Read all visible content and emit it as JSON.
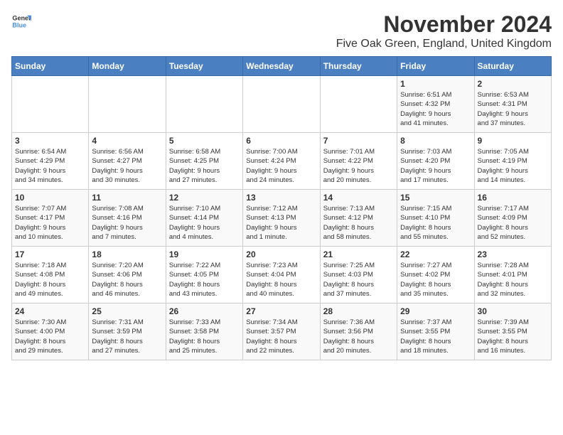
{
  "header": {
    "logo_general": "General",
    "logo_blue": "Blue",
    "month_title": "November 2024",
    "location": "Five Oak Green, England, United Kingdom"
  },
  "weekdays": [
    "Sunday",
    "Monday",
    "Tuesday",
    "Wednesday",
    "Thursday",
    "Friday",
    "Saturday"
  ],
  "weeks": [
    [
      {
        "day": "",
        "info": ""
      },
      {
        "day": "",
        "info": ""
      },
      {
        "day": "",
        "info": ""
      },
      {
        "day": "",
        "info": ""
      },
      {
        "day": "",
        "info": ""
      },
      {
        "day": "1",
        "info": "Sunrise: 6:51 AM\nSunset: 4:32 PM\nDaylight: 9 hours\nand 41 minutes."
      },
      {
        "day": "2",
        "info": "Sunrise: 6:53 AM\nSunset: 4:31 PM\nDaylight: 9 hours\nand 37 minutes."
      }
    ],
    [
      {
        "day": "3",
        "info": "Sunrise: 6:54 AM\nSunset: 4:29 PM\nDaylight: 9 hours\nand 34 minutes."
      },
      {
        "day": "4",
        "info": "Sunrise: 6:56 AM\nSunset: 4:27 PM\nDaylight: 9 hours\nand 30 minutes."
      },
      {
        "day": "5",
        "info": "Sunrise: 6:58 AM\nSunset: 4:25 PM\nDaylight: 9 hours\nand 27 minutes."
      },
      {
        "day": "6",
        "info": "Sunrise: 7:00 AM\nSunset: 4:24 PM\nDaylight: 9 hours\nand 24 minutes."
      },
      {
        "day": "7",
        "info": "Sunrise: 7:01 AM\nSunset: 4:22 PM\nDaylight: 9 hours\nand 20 minutes."
      },
      {
        "day": "8",
        "info": "Sunrise: 7:03 AM\nSunset: 4:20 PM\nDaylight: 9 hours\nand 17 minutes."
      },
      {
        "day": "9",
        "info": "Sunrise: 7:05 AM\nSunset: 4:19 PM\nDaylight: 9 hours\nand 14 minutes."
      }
    ],
    [
      {
        "day": "10",
        "info": "Sunrise: 7:07 AM\nSunset: 4:17 PM\nDaylight: 9 hours\nand 10 minutes."
      },
      {
        "day": "11",
        "info": "Sunrise: 7:08 AM\nSunset: 4:16 PM\nDaylight: 9 hours\nand 7 minutes."
      },
      {
        "day": "12",
        "info": "Sunrise: 7:10 AM\nSunset: 4:14 PM\nDaylight: 9 hours\nand 4 minutes."
      },
      {
        "day": "13",
        "info": "Sunrise: 7:12 AM\nSunset: 4:13 PM\nDaylight: 9 hours\nand 1 minute."
      },
      {
        "day": "14",
        "info": "Sunrise: 7:13 AM\nSunset: 4:12 PM\nDaylight: 8 hours\nand 58 minutes."
      },
      {
        "day": "15",
        "info": "Sunrise: 7:15 AM\nSunset: 4:10 PM\nDaylight: 8 hours\nand 55 minutes."
      },
      {
        "day": "16",
        "info": "Sunrise: 7:17 AM\nSunset: 4:09 PM\nDaylight: 8 hours\nand 52 minutes."
      }
    ],
    [
      {
        "day": "17",
        "info": "Sunrise: 7:18 AM\nSunset: 4:08 PM\nDaylight: 8 hours\nand 49 minutes."
      },
      {
        "day": "18",
        "info": "Sunrise: 7:20 AM\nSunset: 4:06 PM\nDaylight: 8 hours\nand 46 minutes."
      },
      {
        "day": "19",
        "info": "Sunrise: 7:22 AM\nSunset: 4:05 PM\nDaylight: 8 hours\nand 43 minutes."
      },
      {
        "day": "20",
        "info": "Sunrise: 7:23 AM\nSunset: 4:04 PM\nDaylight: 8 hours\nand 40 minutes."
      },
      {
        "day": "21",
        "info": "Sunrise: 7:25 AM\nSunset: 4:03 PM\nDaylight: 8 hours\nand 37 minutes."
      },
      {
        "day": "22",
        "info": "Sunrise: 7:27 AM\nSunset: 4:02 PM\nDaylight: 8 hours\nand 35 minutes."
      },
      {
        "day": "23",
        "info": "Sunrise: 7:28 AM\nSunset: 4:01 PM\nDaylight: 8 hours\nand 32 minutes."
      }
    ],
    [
      {
        "day": "24",
        "info": "Sunrise: 7:30 AM\nSunset: 4:00 PM\nDaylight: 8 hours\nand 29 minutes."
      },
      {
        "day": "25",
        "info": "Sunrise: 7:31 AM\nSunset: 3:59 PM\nDaylight: 8 hours\nand 27 minutes."
      },
      {
        "day": "26",
        "info": "Sunrise: 7:33 AM\nSunset: 3:58 PM\nDaylight: 8 hours\nand 25 minutes."
      },
      {
        "day": "27",
        "info": "Sunrise: 7:34 AM\nSunset: 3:57 PM\nDaylight: 8 hours\nand 22 minutes."
      },
      {
        "day": "28",
        "info": "Sunrise: 7:36 AM\nSunset: 3:56 PM\nDaylight: 8 hours\nand 20 minutes."
      },
      {
        "day": "29",
        "info": "Sunrise: 7:37 AM\nSunset: 3:55 PM\nDaylight: 8 hours\nand 18 minutes."
      },
      {
        "day": "30",
        "info": "Sunrise: 7:39 AM\nSunset: 3:55 PM\nDaylight: 8 hours\nand 16 minutes."
      }
    ]
  ]
}
